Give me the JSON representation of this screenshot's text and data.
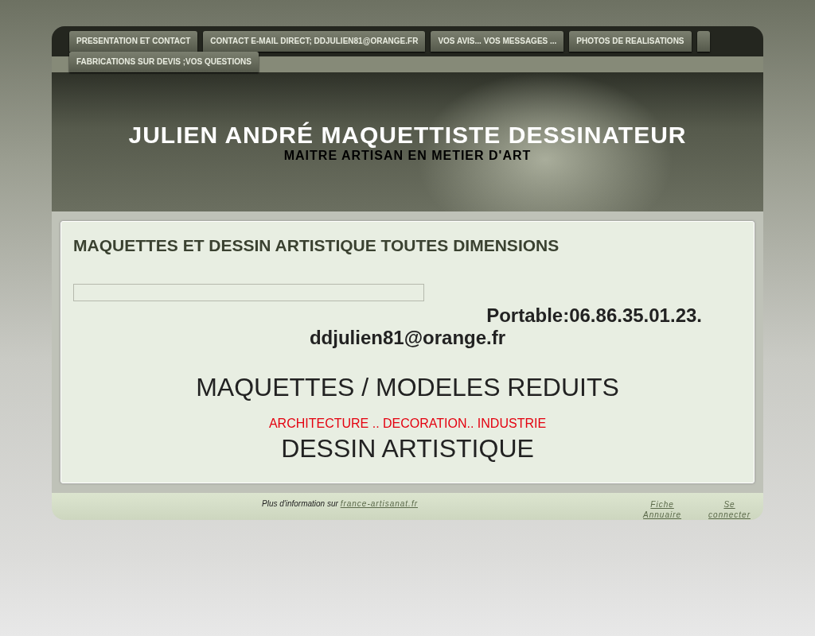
{
  "nav": {
    "items": [
      {
        "kind": "text",
        "label": "PRESENTATION ET CONTACT"
      },
      {
        "kind": "text",
        "label": "CONTACT E-MAIL DIRECT; DDJULIEN81@ORANGE.FR"
      },
      {
        "kind": "text",
        "label": "VOS AVIS... VOS MESSAGES ..."
      },
      {
        "kind": "text",
        "label": "PHOTOS DE REALISATIONS"
      },
      {
        "kind": "blank"
      },
      {
        "kind": "text",
        "label": "FABRICATIONS SUR DEVIS ;VOS QUESTIONS"
      }
    ]
  },
  "header": {
    "title": "JULIEN ANDRÉ MAQUETTISTE DESSINATEUR",
    "subtitle": "MAITRE ARTISAN EN METIER D'ART"
  },
  "content": {
    "heading": "MAQUETTES ET DESSIN ARTISTIQUE TOUTES DIMENSIONS",
    "phone": "Portable:06.86.35.01.23.",
    "email": "ddjulien81@orange.fr",
    "headline": "MAQUETTES / MODELES REDUITS",
    "categories": "ARCHITECTURE .. DECORATION.. INDUSTRIE",
    "subheadline": "DESSIN ARTISTIQUE"
  },
  "footer": {
    "info": "Plus d'information sur",
    "info_link": "france-artisanat.fr",
    "links": [
      {
        "lines": [
          "Fiche",
          "Annuaire"
        ]
      },
      {
        "lines": [
          "Se",
          "connecter"
        ]
      }
    ]
  }
}
